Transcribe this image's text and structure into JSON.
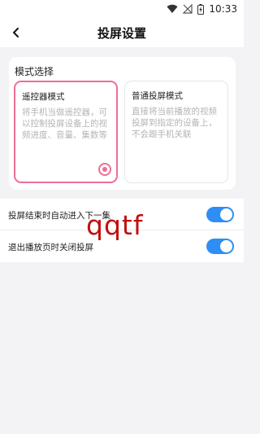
{
  "status_bar": {
    "time": "10:33",
    "icons": [
      "wifi-icon",
      "no-signal-icon",
      "battery-charging-icon"
    ]
  },
  "header": {
    "title": "投屏设置",
    "back_icon": "back-arrow-icon"
  },
  "mode_section": {
    "title": "模式选择",
    "options": [
      {
        "title": "遥控器模式",
        "description": "将手机当做遥控器，可以控制投屏设备上的视频进度、音量、集数等",
        "selected": true
      },
      {
        "title": "普通投屏模式",
        "description": "直接将当前播放的视频投屏到指定的设备上，不会跟手机关联",
        "selected": false
      }
    ],
    "accent_color": "#ef6f96"
  },
  "settings": [
    {
      "label": "投屏结束时自动进入下一集",
      "enabled": true
    },
    {
      "label": "退出播放页时关闭投屏",
      "enabled": true
    }
  ],
  "toggle_color": "#2f8ef4",
  "overlay_text": "qqtf",
  "overlay_color": "#c01010"
}
